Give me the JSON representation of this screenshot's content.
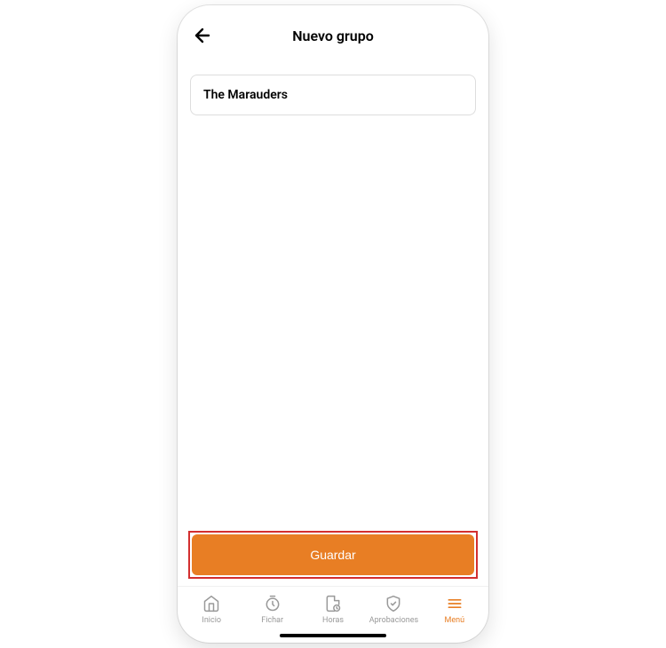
{
  "header": {
    "title": "Nuevo grupo"
  },
  "form": {
    "group_name_value": "The Marauders"
  },
  "actions": {
    "save_label": "Guardar"
  },
  "nav": {
    "items": [
      {
        "label": "Inicio"
      },
      {
        "label": "Fichar"
      },
      {
        "label": "Horas"
      },
      {
        "label": "Aprobaciones"
      },
      {
        "label": "Menú"
      }
    ]
  },
  "colors": {
    "accent": "#e87e24",
    "highlight_border": "#d32f2f"
  }
}
